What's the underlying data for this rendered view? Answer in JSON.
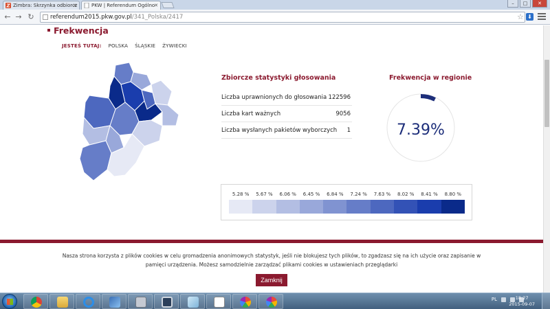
{
  "browser": {
    "tabs": [
      {
        "label": "Zimbra: Skrzynka odbiorcz"
      },
      {
        "label": "PKW | Referendum Ogólno"
      }
    ],
    "url_host": "referendum2015.pkw.gov.pl",
    "url_path": "/341_Polska/2417"
  },
  "page": {
    "section_title": "Frekwencja",
    "breadcrumb": {
      "here_label": "JESTEŚ TUTAJ:",
      "items": [
        "POLSKA",
        "ŚLĄSKIE",
        "ŻYWIECKI"
      ]
    },
    "stats": {
      "title": "Zbiorcze statystyki głosowania",
      "rows": [
        {
          "label": "Liczba uprawnionych do głosowania",
          "value": "122596"
        },
        {
          "label": "Liczba kart ważnych",
          "value": "9056"
        },
        {
          "label": "Liczba wysłanych pakietów wyborczych",
          "value": "1"
        }
      ]
    },
    "turnout": {
      "title": "Frekwencja w regionie",
      "value_text": "7.39%",
      "fraction": 0.0739,
      "gauge_color": "#1d2e7a"
    },
    "legend": {
      "labels": [
        "5.28 %",
        "5.67 %",
        "6.06 %",
        "6.45 %",
        "6.84 %",
        "7.24 %",
        "7.63 %",
        "8.02 %",
        "8.41 %",
        "8.80 %"
      ],
      "colors": [
        "#e6e9f5",
        "#ccd3ec",
        "#b3bee3",
        "#99a8da",
        "#8093d1",
        "#667dc8",
        "#4d68bf",
        "#3352b6",
        "#1a3dad",
        "#0a2a8a"
      ]
    },
    "cookie": {
      "text": "Nasza strona korzysta z plików cookies w celu gromadzenia anonimowych statystyk, jeśli nie blokujesz tych plików, to zgadzasz się na ich użycie oraz zapisanie w pamięci urządzenia. Możesz samodzielnie zarządzać plikami cookies w ustawieniach przeglądarki",
      "button": "Zamknij"
    },
    "accent_color": "#8b1a2f"
  },
  "taskbar": {
    "lang": "PL",
    "time": "18:27",
    "date": "2015-09-07"
  }
}
